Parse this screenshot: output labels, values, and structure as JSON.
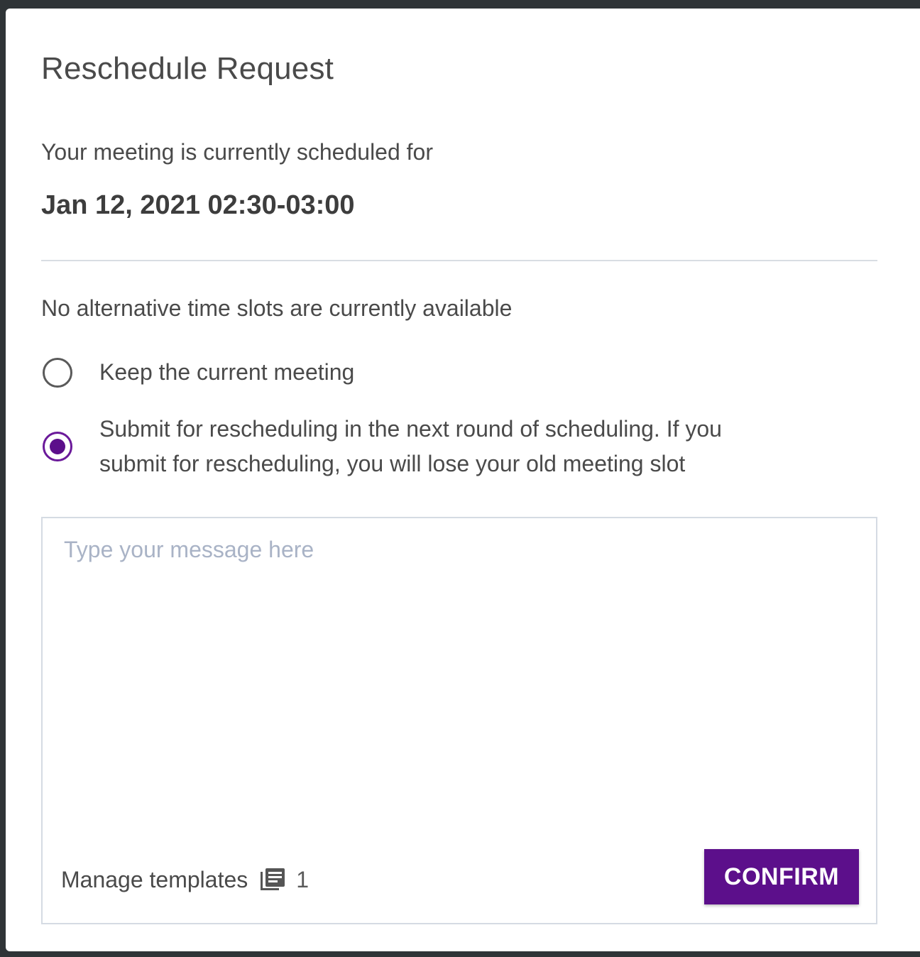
{
  "dialog": {
    "title": "Reschedule Request",
    "subtitle": "Your meeting is currently scheduled for",
    "datetime": "Jan 12, 2021 02:30-03:00",
    "notice": "No alternative time slots are currently available",
    "options": [
      {
        "label": "Keep the current meeting",
        "checked": false
      },
      {
        "label": "Submit for rescheduling in the next round of scheduling. If you submit for rescheduling, you will lose your old meeting slot",
        "checked": true
      }
    ],
    "message": {
      "placeholder": "Type your message here",
      "value": ""
    },
    "manage_templates_label": "Manage templates",
    "template_count": "1",
    "confirm_label": "CONFIRM"
  },
  "colors": {
    "accent": "#5c0f8b",
    "placeholder": "#a9b3c6",
    "text": "#4a4a4a",
    "background_frame": "#2f3437"
  },
  "icons": {
    "template": "template-stack-icon"
  }
}
